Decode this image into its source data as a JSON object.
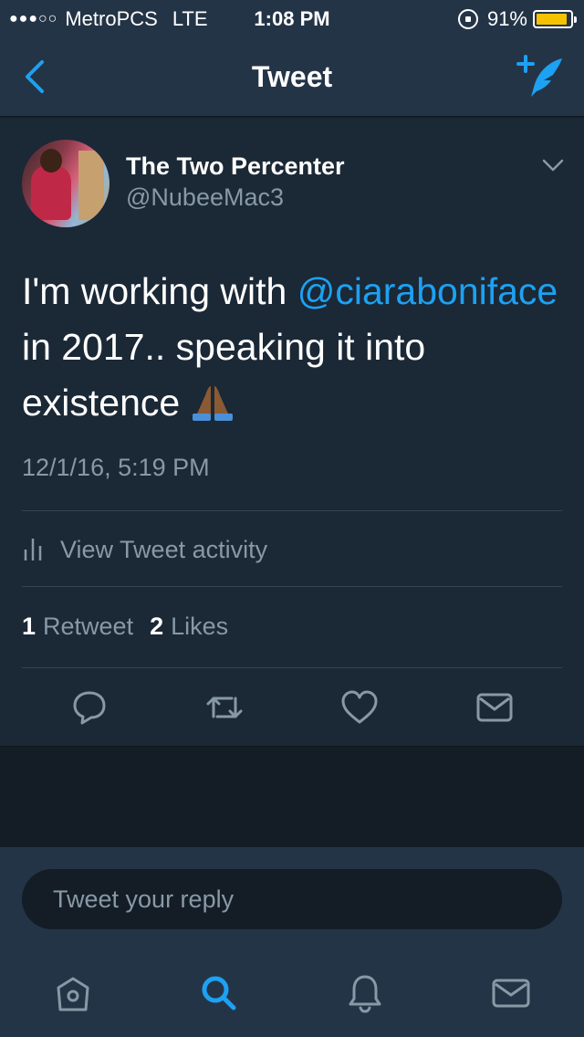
{
  "status_bar": {
    "signal_dots": "●●●○○",
    "carrier": "MetroPCS",
    "network": "LTE",
    "time": "1:08 PM",
    "battery_percent": "91%",
    "battery_level": 0.91,
    "battery_color": "#f5c200"
  },
  "nav": {
    "title": "Tweet",
    "back_icon": "chevron-left-icon",
    "compose_icon": "compose-tweet-icon"
  },
  "tweet": {
    "author_name": "The Two Percenter",
    "author_handle": "@NubeeMac3",
    "text_before": "I'm working with ",
    "mention": "@ciaraboniface",
    "text_after": " in 2017.. speaking it into existence ",
    "emoji": "folded-hands-icon",
    "timestamp": "12/1/16, 5:19 PM",
    "activity_label": "View Tweet activity",
    "retweet_count": "1",
    "retweet_label": "Retweet",
    "like_count": "2",
    "like_label": "Likes"
  },
  "reply": {
    "placeholder": "Tweet your reply"
  },
  "colors": {
    "accent": "#1da1f2",
    "card_bg": "#1b2836",
    "bar_bg": "#243447",
    "muted_text": "#8899a6"
  }
}
